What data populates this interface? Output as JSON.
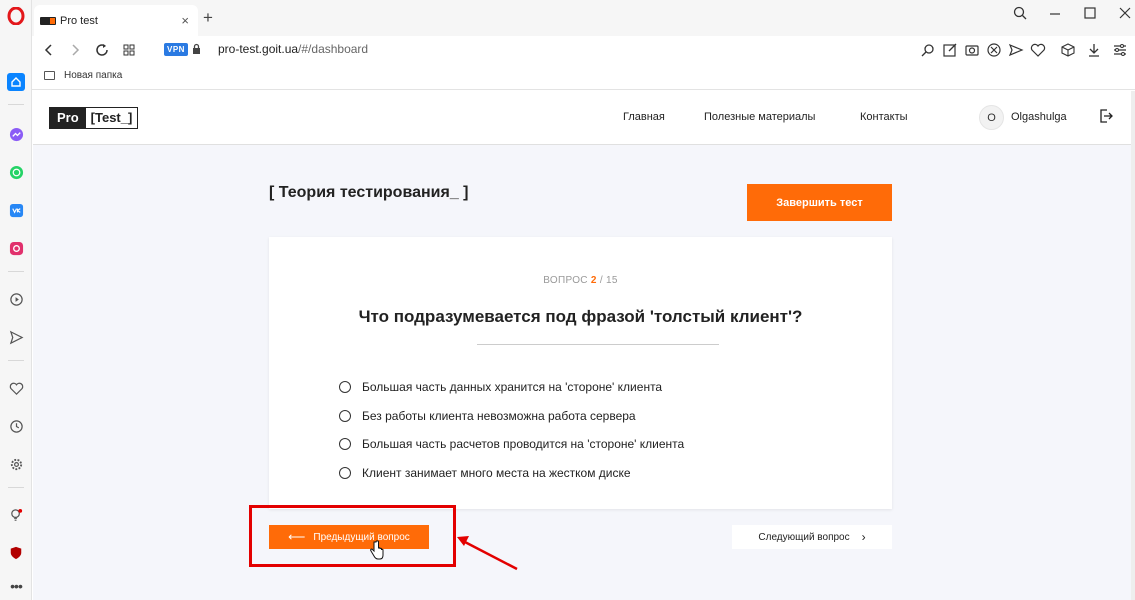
{
  "browser": {
    "tab_title": "Pro test",
    "tab_close": "×",
    "new_tab": "+",
    "vpn_label": "VPN",
    "url_domain": "pro-test.goit.ua",
    "url_path": "/#/dashboard",
    "bookmark_folder": "Новая папка"
  },
  "site": {
    "logo_pro": "Pro",
    "logo_test": "[Test_]",
    "nav": [
      "Главная",
      "Полезные материалы",
      "Контакты"
    ],
    "avatar_initial": "O",
    "username": "Olgashulga"
  },
  "quiz": {
    "title": "[ Теория тестирования_ ]",
    "finish_button": "Завершить тест",
    "question_label": "ВОПРОС",
    "question_current": "2",
    "question_total": "/ 15",
    "question_text": "Что подразумевается под фразой 'толстый клиент'?",
    "answers": [
      "Большая часть данных хранится на 'стороне' клиента",
      "Без работы клиента невозможна работа сервера",
      "Большая часть расчетов проводится на 'стороне' клиента",
      "Клиент занимает много места на жестком диске"
    ],
    "prev_button": "Предыдущий вопрос",
    "next_button": "Следующий вопрос"
  },
  "colors": {
    "accent": "#ff6b08",
    "annotation": "#e30000"
  }
}
